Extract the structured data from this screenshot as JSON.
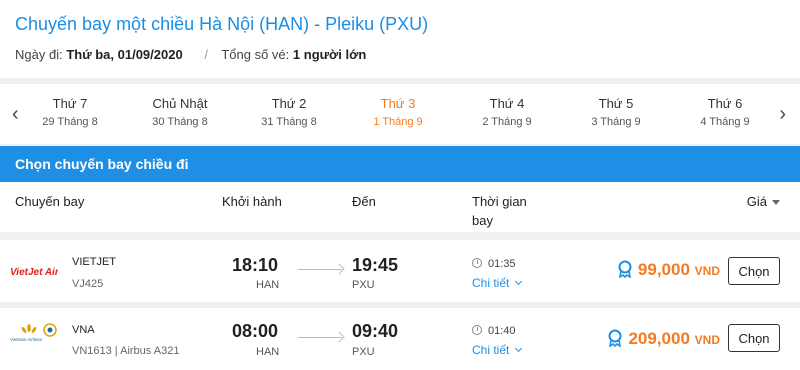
{
  "header": {
    "title": "Chuyến bay một chiều Hà Nội (HAN) - Pleiku (PXU)",
    "date_label": "Ngày đi:",
    "date_value": "Thứ ba, 01/09/2020",
    "separator": "/",
    "tickets_label": "Tổng số vé:",
    "tickets_value": "1 người lớn"
  },
  "date_strip": {
    "prev_icon": "chevron-left-icon",
    "next_icon": "chevron-right-icon",
    "days": [
      {
        "name": "Thứ 7",
        "date": "29 Tháng 8",
        "active": false
      },
      {
        "name": "Chủ Nhật",
        "date": "30 Tháng 8",
        "active": false
      },
      {
        "name": "Thứ 2",
        "date": "31 Tháng 8",
        "active": false
      },
      {
        "name": "Thứ 3",
        "date": "1 Tháng 9",
        "active": true
      },
      {
        "name": "Thứ 4",
        "date": "2 Tháng 9",
        "active": false
      },
      {
        "name": "Thứ 5",
        "date": "3 Tháng 9",
        "active": false
      },
      {
        "name": "Thứ 6",
        "date": "4 Tháng 9",
        "active": false
      }
    ]
  },
  "section": {
    "title": "Chọn chuyến bay chiều đi"
  },
  "columns": {
    "flight": "Chuyến bay",
    "depart": "Khởi hành",
    "arrive": "Đến",
    "duration": "Thời gian bay",
    "price": "Giá"
  },
  "flights": [
    {
      "airline": "VIETJET",
      "code": "VJ425",
      "logo_text": "VietJet Air",
      "dep_time": "18:10",
      "dep_airport": "HAN",
      "arr_time": "19:45",
      "arr_airport": "PXU",
      "duration": "01:35",
      "detail_label": "Chi tiết",
      "price": "99,000",
      "currency": "VND",
      "choose_label": "Chọn"
    },
    {
      "airline": "VNA",
      "code": "VN1613  |  Airbus A321",
      "logo_text": "Vietnam Airlines",
      "dep_time": "08:00",
      "dep_airport": "HAN",
      "arr_time": "09:40",
      "arr_airport": "PXU",
      "duration": "01:40",
      "detail_label": "Chi tiết",
      "price": "209,000",
      "currency": "VND",
      "choose_label": "Chọn"
    }
  ],
  "colors": {
    "accent": "#1f8fe6",
    "price": "#f47b20",
    "vietjet": "#e2231a",
    "vna_gold": "#d9a400"
  }
}
